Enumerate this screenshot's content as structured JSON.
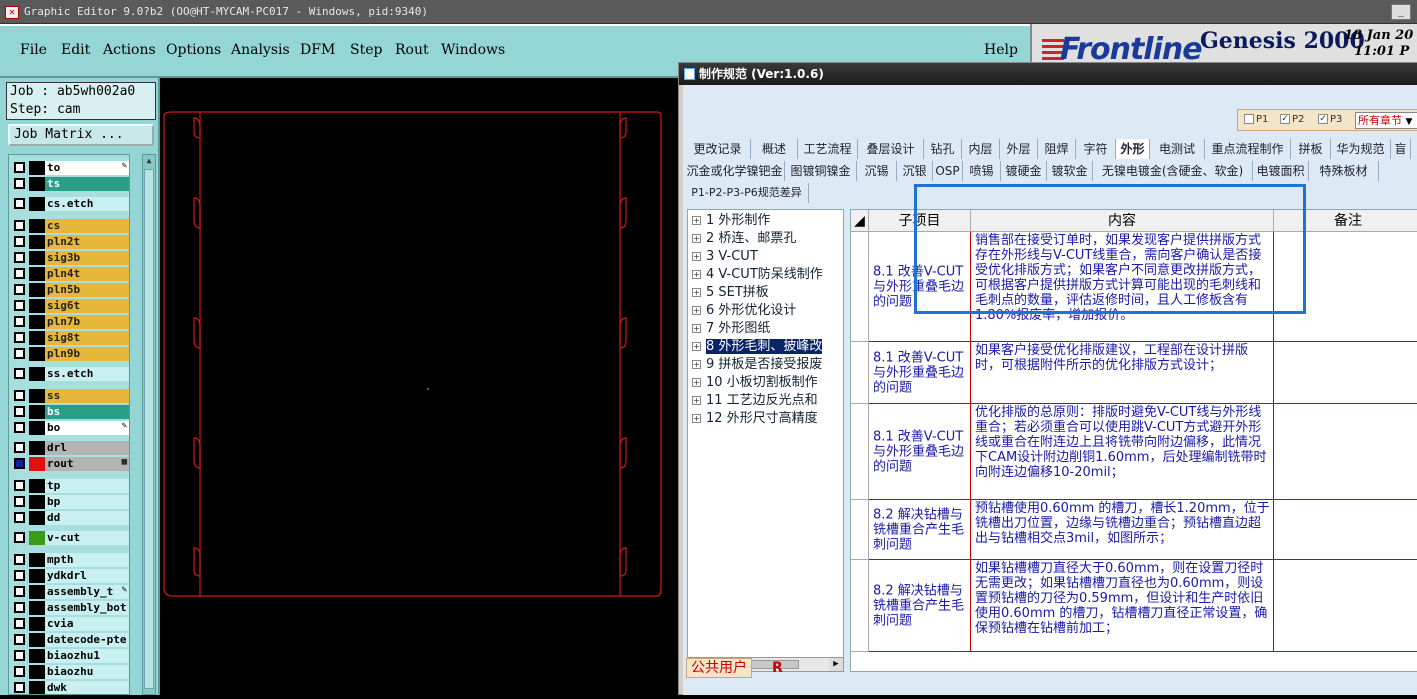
{
  "window": {
    "title": "Graphic Editor 9.0?b2 (OO@HT-MYCAM-PC017 - Windows, pid:9340)",
    "min": "_"
  },
  "menu": [
    "File",
    "Edit",
    "Actions",
    "Options",
    "Analysis",
    "DFM",
    "Step",
    "Rout",
    "Windows"
  ],
  "help": "Help",
  "brand": {
    "logo": "Frontline",
    "product": "Genesis 2000",
    "date": "18 Jan 20",
    "time": "11:01 P"
  },
  "job": {
    "job_line": "Job : ab5wh002a0",
    "step_line": "Step: cam",
    "matrix_button": "Job Matrix ..."
  },
  "layers": [
    {
      "name": "to",
      "style": "white",
      "mark": "✎"
    },
    {
      "name": "ts",
      "style": "teal"
    },
    {
      "name": "cs.etch",
      "style": "light"
    },
    {
      "name": "cs",
      "style": "gold"
    },
    {
      "name": "pln2t",
      "style": "gold"
    },
    {
      "name": "sig3b",
      "style": "gold"
    },
    {
      "name": "pln4t",
      "style": "gold"
    },
    {
      "name": "pln5b",
      "style": "gold"
    },
    {
      "name": "sig6t",
      "style": "gold"
    },
    {
      "name": "pln7b",
      "style": "gold"
    },
    {
      "name": "sig8t",
      "style": "gold"
    },
    {
      "name": "pln9b",
      "style": "gold"
    },
    {
      "name": "ss.etch",
      "style": "light"
    },
    {
      "name": "ss",
      "style": "gold"
    },
    {
      "name": "bs",
      "style": "teal"
    },
    {
      "name": "bo",
      "style": "white",
      "mark": "✎"
    },
    {
      "name": "drl",
      "style": "grey"
    },
    {
      "name": "rout",
      "style": "grey",
      "mark": "▦",
      "active": true
    },
    {
      "name": "tp",
      "style": "light"
    },
    {
      "name": "bp",
      "style": "light"
    },
    {
      "name": "dd",
      "style": "light"
    },
    {
      "name": "v-cut",
      "style": "light",
      "green": true
    },
    {
      "name": "mpth",
      "style": "light"
    },
    {
      "name": "ydkdrl",
      "style": "light"
    },
    {
      "name": "assembly_t",
      "style": "light",
      "mark": "✎"
    },
    {
      "name": "assembly_bot",
      "style": "light"
    },
    {
      "name": "cvia",
      "style": "light"
    },
    {
      "name": "datecode-pte",
      "style": "light"
    },
    {
      "name": "biaozhu1",
      "style": "light"
    },
    {
      "name": "biaozhu",
      "style": "light"
    },
    {
      "name": "dwk",
      "style": "light"
    }
  ],
  "dialog": {
    "title": "制作规范 (Ver:1.0.6)",
    "p1": "P1",
    "p2": "P2",
    "p3": "P3",
    "chapter_select": "所有章节",
    "tabs_row1": [
      "更改记录",
      "概述",
      "工艺流程",
      "叠层设计",
      "钻孔",
      "内层",
      "外层",
      "阻焊",
      "字符",
      "外形",
      "电测试",
      "重点流程制作",
      "拼板",
      "华为规范",
      "盲"
    ],
    "active_tab": "外形",
    "tabs_row2": [
      "沉金或化学镍钯金",
      "图镀铜镍金",
      "沉锡",
      "沉银",
      "OSP",
      "喷锡",
      "镀硬金",
      "镀软金",
      "无镍电镀金(含硬金、软金)",
      "电镀面积",
      "特殊板材"
    ],
    "tabs_row3": [
      "P1-P2-P3-P6规范差异"
    ],
    "tree": [
      "1 外形制作",
      "2 桥连、邮票孔",
      "3 V-CUT",
      "4 V-CUT防呆线制作",
      "5 SET拼板",
      "6 外形优化设计",
      "7 外形图纸",
      "8 外形毛刺、披峰改",
      "9 拼板是否接受报废",
      "10 小板切割板制作",
      "11 工艺边反光点和",
      "12 外形尺寸高精度"
    ],
    "selected_tree_index": 7,
    "columns": [
      "子项目",
      "内容",
      "备注"
    ],
    "rows": [
      {
        "sub": "8.1 改善V-CUT与外形重叠毛边的问题",
        "content": "销售部在接受订单时，如果发现客户提供拼版方式存在外形线与V-CUT线重合，需向客户确认是否接受优化排版方式；如果客户不同意更改拼版方式，可根据客户提供拼版方式计算可能出现的毛刺线和毛刺点的数量，评估返修时间，且人工修板含有1.80%报废率，增加报价。",
        "note": ""
      },
      {
        "sub": "8.1 改善V-CUT与外形重叠毛边的问题",
        "content": "如果客户接受优化排版建议，工程部在设计拼版时，可根据附件所示的优化排版方式设计；",
        "note": ""
      },
      {
        "sub": "8.1 改善V-CUT与外形重叠毛边的问题",
        "content": "优化排版的总原则：排版时避免V-CUT线与外形线重合；若必须重合可以使用跳V-CUT方式避开外形线或重合在附连边上且将铣带向附边偏移，此情况下CAM设计附边削铜1.60mm，后处理编制铣带时向附连边偏移10-20mil；",
        "note": ""
      },
      {
        "sub": "8.2 解决钻槽与铣槽重合产生毛刺问题",
        "content": "预钻槽使用0.60mm 的槽刀，槽长1.20mm，位于铣槽出刀位置，边缘与铣槽边重合；预钻槽直边超出与钻槽相交点3mil，如图所示；",
        "note": ""
      },
      {
        "sub": "8.2 解决钻槽与铣槽重合产生毛刺问题",
        "content": "如果钻槽槽刀直径大于0.60mm，则在设置刀径时无需更改；如果钻槽槽刀直径也为0.60mm，则设置预钻槽的刀径为0.59mm，但设计和生产时依旧使用0.60mm 的槽刀，钻槽槽刀直径正常设置，确保预钻槽在钻槽前加工；",
        "note": ""
      }
    ],
    "footer_user": "公共用户",
    "footer_r": "R"
  }
}
